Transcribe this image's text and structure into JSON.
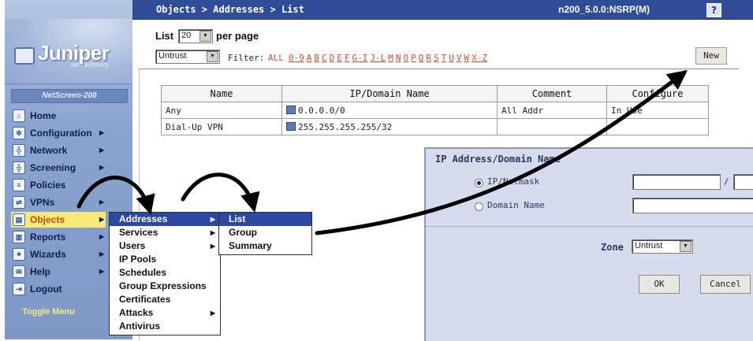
{
  "header": {
    "breadcrumb": "Objects > Addresses > List",
    "device": "n200_5.0.0:NSRP(M)",
    "help": "?"
  },
  "logo": {
    "name": "Juniper",
    "sub": "NETWORKS"
  },
  "sidebar": {
    "device_label": "NetScreen-208",
    "items": [
      {
        "label": "Home",
        "icon": "home-icon",
        "has_arrow": false
      },
      {
        "label": "Configuration",
        "icon": "gear-icon",
        "has_arrow": true
      },
      {
        "label": "Network",
        "icon": "network-icon",
        "has_arrow": true
      },
      {
        "label": "Screening",
        "icon": "screening-icon",
        "has_arrow": true
      },
      {
        "label": "Policies",
        "icon": "policy-icon",
        "has_arrow": false
      },
      {
        "label": "VPNs",
        "icon": "vpn-icon",
        "has_arrow": true
      },
      {
        "label": "Objects",
        "icon": "objects-icon",
        "has_arrow": true
      },
      {
        "label": "Reports",
        "icon": "reports-icon",
        "has_arrow": true
      },
      {
        "label": "Wizards",
        "icon": "wizard-icon",
        "has_arrow": true
      },
      {
        "label": "Help",
        "icon": "help-icon",
        "has_arrow": true
      },
      {
        "label": "Logout",
        "icon": "logout-icon",
        "has_arrow": false
      }
    ],
    "toggle": "Toggle Menu"
  },
  "controls": {
    "list_label": "List",
    "per_page_value": "20",
    "per_page_label": "per page",
    "zone_value": "Untrust",
    "filter_label": "Filter:",
    "filter_letters": [
      "ALL",
      "0-9",
      "A",
      "B",
      "C",
      "D",
      "E",
      "F",
      "G-I",
      "J-L",
      "M",
      "N",
      "O",
      "P",
      "Q",
      "R",
      "S",
      "T",
      "U",
      "V",
      "W",
      "X-Z"
    ],
    "new_label": "New"
  },
  "table": {
    "headers": [
      "Name",
      "IP/Domain Name",
      "Comment",
      "Configure"
    ],
    "rows": [
      {
        "name": "Any",
        "ip": "0.0.0.0/0",
        "comment": "All Addr",
        "configure": "In Use"
      },
      {
        "name": "Dial-Up VPN",
        "ip": "255.255.255.255/32",
        "comment": "",
        "configure": ""
      }
    ]
  },
  "dialog": {
    "title": "IP Address/Domain Name",
    "ip_netmask": "IP/Netmask",
    "domain_name": "Domain Name",
    "separator": "/",
    "zone_label": "Zone",
    "zone_value": "Untrust",
    "ok": "OK",
    "cancel": "Cancel"
  },
  "objects_menu": [
    {
      "label": "Addresses",
      "has_arrow": true,
      "selected": true
    },
    {
      "label": "Services",
      "has_arrow": true
    },
    {
      "label": "Users",
      "has_arrow": true
    },
    {
      "label": "IP Pools",
      "has_arrow": false
    },
    {
      "label": "Schedules",
      "has_arrow": false
    },
    {
      "label": "Group Expressions",
      "has_arrow": false
    },
    {
      "label": "Certificates",
      "has_arrow": false
    },
    {
      "label": "Attacks",
      "has_arrow": true
    },
    {
      "label": "Antivirus",
      "has_arrow": false
    }
  ],
  "addresses_menu": [
    {
      "label": "List",
      "selected": true
    },
    {
      "label": "Group"
    },
    {
      "label": "Summary"
    }
  ],
  "colors": {
    "header_bg": "#2f4d97",
    "menu_selected": "#2c48a0",
    "active_nav_bg": "#f5e97a",
    "filter_link": "#d84a2a",
    "dialog_bg": "#d6dced"
  }
}
